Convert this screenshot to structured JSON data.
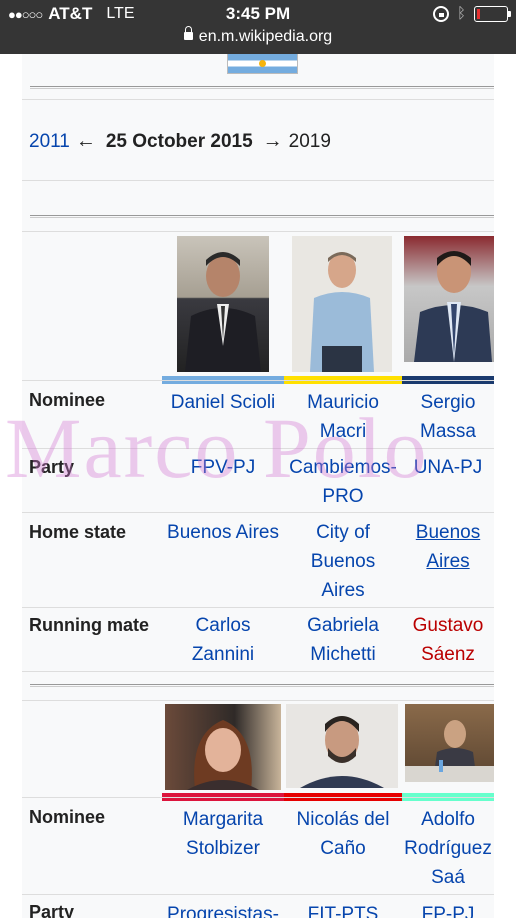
{
  "status_bar": {
    "signal_dots": "●●○○○",
    "carrier": "AT&T",
    "network": "LTE",
    "time": "3:45 PM",
    "url": "en.m.wikipedia.org"
  },
  "election_nav": {
    "previous": "2011",
    "left_arrow": "←",
    "current": "25 October 2015",
    "right_arrow": "→",
    "next": "2019"
  },
  "row_labels": {
    "nominee": "Nominee",
    "party": "Party",
    "home_state": "Home state",
    "running_mate": "Running mate"
  },
  "candidates_top": [
    {
      "nominee": "Daniel Scioli",
      "party": "FPV-PJ",
      "home_state": "Buenos Aires",
      "running_mate": "Carlos Zannini",
      "color": "#74acdf"
    },
    {
      "nominee": "Mauricio Macri",
      "party": "Cambiemos-PRO",
      "home_state": "City of Buenos Aires",
      "running_mate": "Gabriela Michetti",
      "color": "#ffe000"
    },
    {
      "nominee": "Sergio Massa",
      "party": "UNA-PJ",
      "home_state": "Buenos Aires",
      "running_mate": "Gustavo Sáenz",
      "color": "#1a3a6e"
    }
  ],
  "candidates_bottom": [
    {
      "nominee": "Margarita Stolbizer",
      "party": "Progresistas-",
      "color": "#dc143c"
    },
    {
      "nominee": "Nicolás del Caño",
      "party": "FIT-PTS",
      "color": "#e60000"
    },
    {
      "nominee": "Adolfo Rodríguez Saá",
      "party": "FP-PJ",
      "color": "#66ffcc"
    }
  ],
  "watermark": "Marco Polo"
}
